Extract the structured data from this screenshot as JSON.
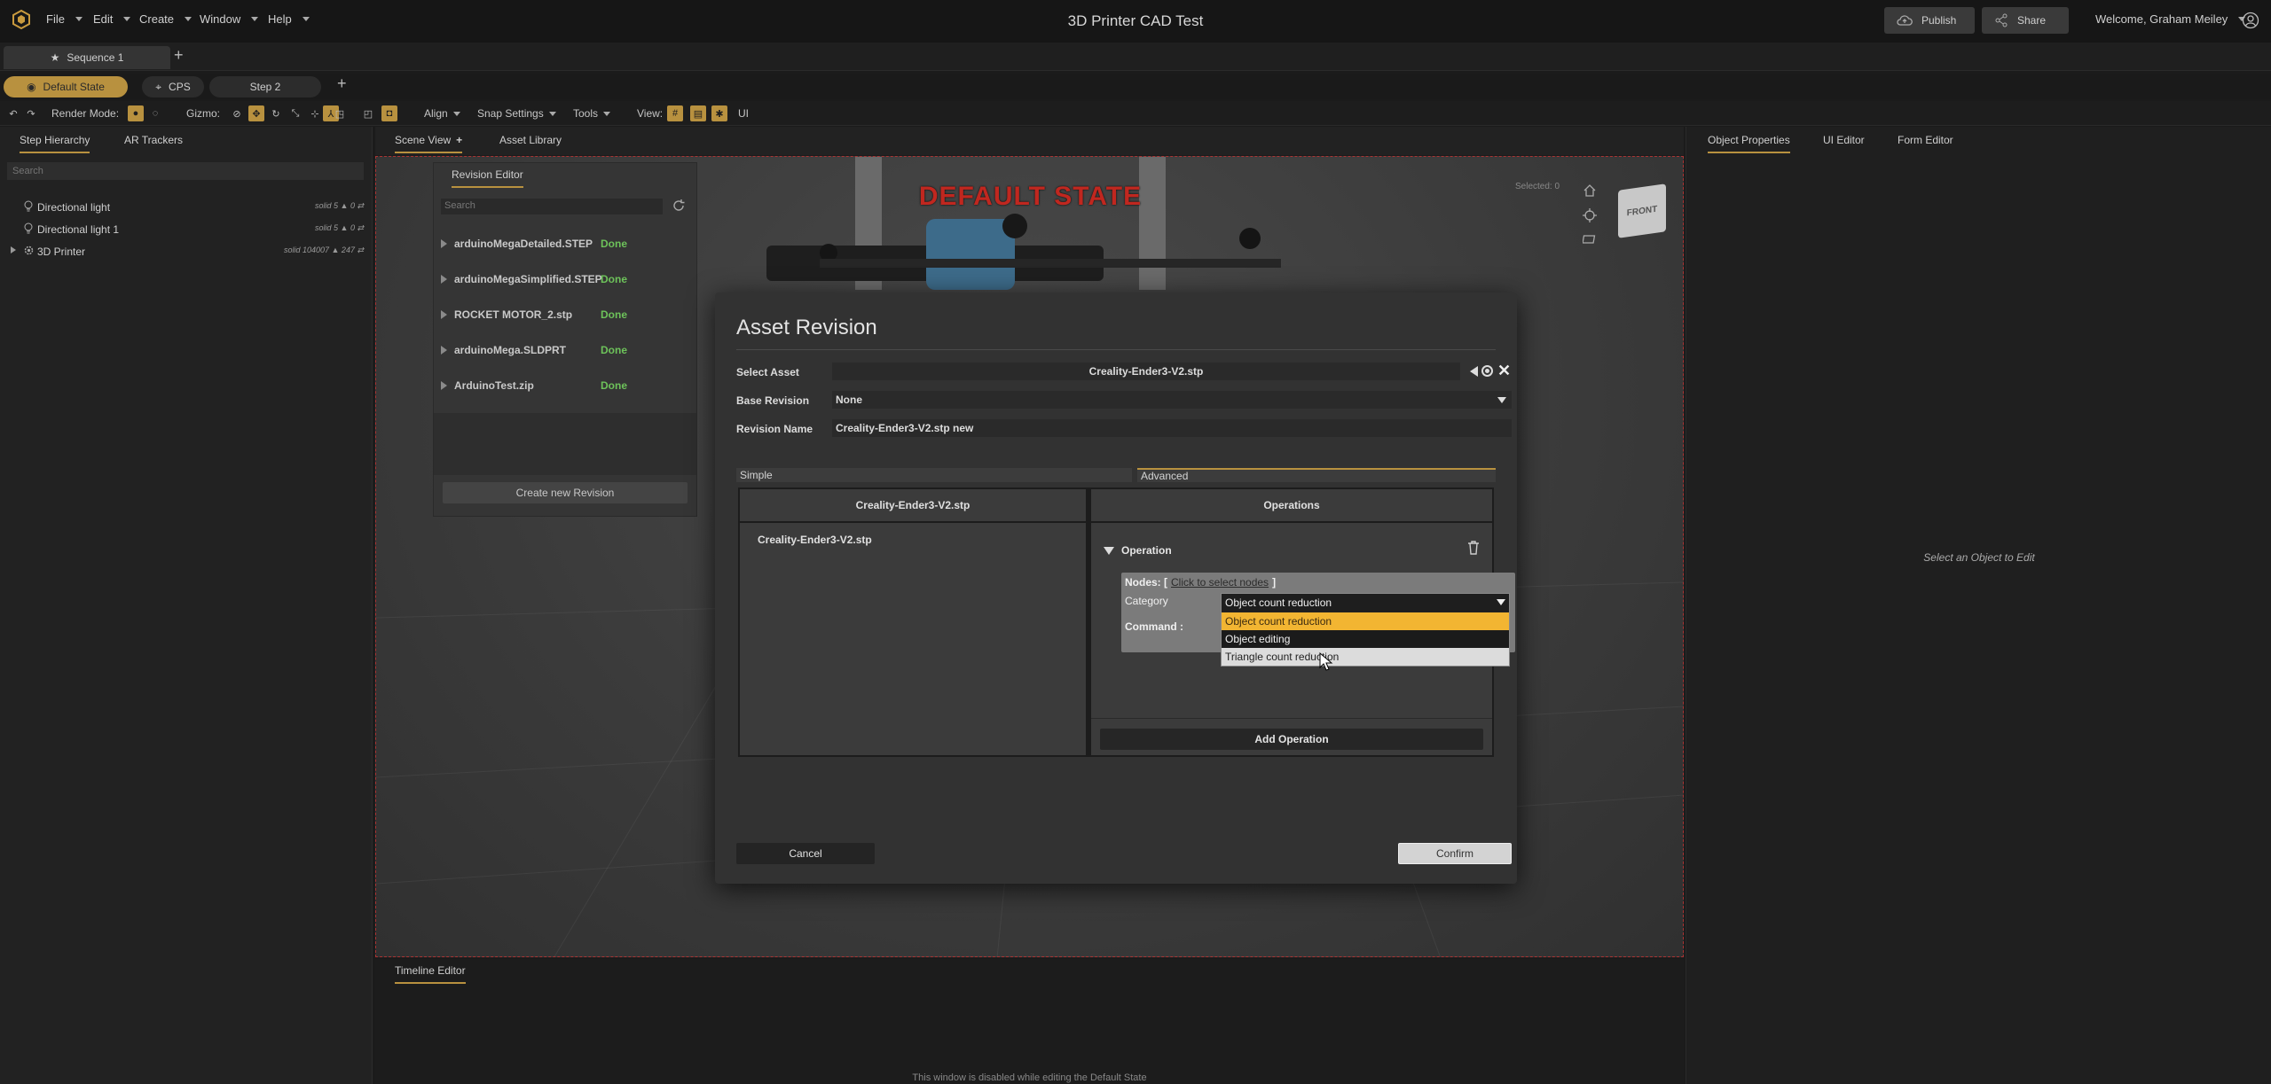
{
  "app": {
    "title": "3D Printer CAD Test",
    "menus": [
      "File",
      "Edit",
      "Create",
      "Window",
      "Help"
    ],
    "publish_label": "Publish",
    "share_label": "Share",
    "user_greeting": "Welcome, Graham Meiley"
  },
  "sequence_tabs": {
    "active": "Sequence 1"
  },
  "step_tabs": [
    "Default State",
    "CPS",
    "Step 2"
  ],
  "toolbar": {
    "render_mode_label": "Render Mode:",
    "gizmo_label": "Gizmo:",
    "align_label": "Align",
    "snap_label": "Snap Settings",
    "tools_label": "Tools",
    "view_label": "View:",
    "ui_label": "UI"
  },
  "left_panel": {
    "tabs": [
      "Step Hierarchy",
      "AR Trackers"
    ],
    "search_placeholder": "Search",
    "items": [
      {
        "label": "Directional light",
        "meta": "solid 5 ▲ 0 ⇄"
      },
      {
        "label": "Directional light 1",
        "meta": "solid 5 ▲ 0 ⇄"
      },
      {
        "label": "3D Printer",
        "meta": "solid 104007 ▲ 247 ⇄"
      }
    ]
  },
  "center": {
    "tabs": [
      "Scene View",
      "Asset Library"
    ],
    "banner": "DEFAULT STATE",
    "view_cube_label": "FRONT",
    "selected_text": "Selected: 0"
  },
  "revision_editor": {
    "title": "Revision Editor",
    "search_placeholder": "Search",
    "rows": [
      {
        "name": "arduinoMegaDetailed.STEP",
        "status": "Done"
      },
      {
        "name": "arduinoMegaSimplified.STEP",
        "status": "Done"
      },
      {
        "name": "ROCKET MOTOR_2.stp",
        "status": "Done"
      },
      {
        "name": "arduinoMega.SLDPRT",
        "status": "Done"
      },
      {
        "name": "ArduinoTest.zip",
        "status": "Done"
      }
    ],
    "create_label": "Create new Revision"
  },
  "right_panel": {
    "tabs": [
      "Object Properties",
      "UI Editor",
      "Form Editor"
    ],
    "empty_text": "Select an Object to Edit"
  },
  "timeline": {
    "tab": "Timeline Editor",
    "disabled_text": "This window is disabled while editing the Default State"
  },
  "modal": {
    "title": "Asset Revision",
    "select_asset_label": "Select Asset",
    "select_asset_value": "Creality-Ender3-V2.stp",
    "base_revision_label": "Base Revision",
    "base_revision_value": "None",
    "revision_name_label": "Revision Name",
    "revision_name_value": "Creality-Ender3-V2.stp new",
    "tabs": {
      "simple": "Simple",
      "advanced": "Advanced"
    },
    "left_header": "Creality-Ender3-V2.stp",
    "left_item": "Creality-Ender3-V2.stp",
    "right_header": "Operations",
    "operation_title": "Operation",
    "nodes_prefix": "Nodes: [",
    "nodes_link": "Click to select nodes",
    "nodes_suffix": "]",
    "category_label": "Category",
    "category_value": "Object count reduction",
    "command_label": "Command :",
    "dropdown_options": [
      "Object count reduction",
      "Object editing",
      "Triangle count reduction"
    ],
    "add_operation_label": "Add Operation",
    "cancel_label": "Cancel",
    "confirm_label": "Confirm"
  },
  "colors": {
    "accent": "#b8913f",
    "banner_red": "#c0271f",
    "done_green": "#6dc25a",
    "dropdown_highlight": "#f2b532"
  }
}
